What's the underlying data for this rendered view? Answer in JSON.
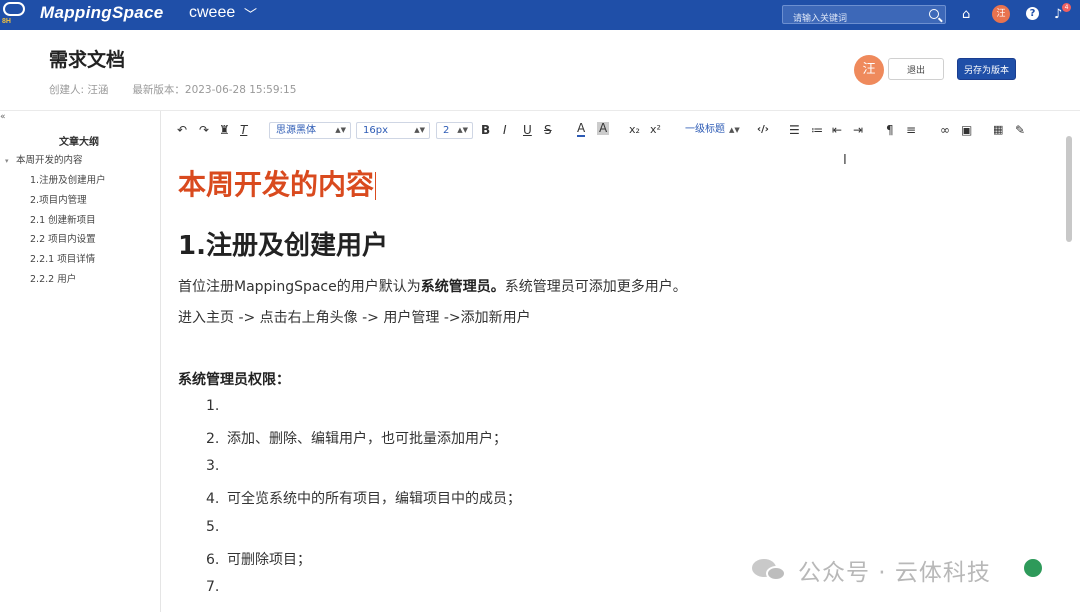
{
  "topbar": {
    "logo_sub": "8H",
    "logo_text": "MappingSpace",
    "project_name": "cweee",
    "search_placeholder": "请输入关键词",
    "avatar_initial": "汪",
    "help_label": "?",
    "bell_count": "4",
    "icons": [
      "home-icon",
      "help-icon",
      "bell-icon",
      "search-icon",
      "chevron-down-icon"
    ],
    "colors": {
      "nav_bg": "#1f4fa8",
      "avatar": "#e8734f"
    }
  },
  "doc": {
    "title": "需求文档",
    "creator": "创建人: 汪涵",
    "latest_version": "最新版本：2023-06-28 15:59:15",
    "avatar_initial": "汪",
    "exit_label": "退出",
    "save_as_label": "另存为版本"
  },
  "sidebar": {
    "collapse_label": "«",
    "outline_title": "文章大纲",
    "items": [
      {
        "label": "本周开发的内容"
      },
      {
        "label": "1.注册及创建用户"
      },
      {
        "label": "2.项目内管理"
      },
      {
        "label": "2.1 创建新项目"
      },
      {
        "label": "2.2 项目内设置"
      },
      {
        "label": "2.2.1 项目详情"
      },
      {
        "label": "2.2.2 用户"
      }
    ]
  },
  "toolbar": {
    "font_family": "思源黑体",
    "font_size": "16px",
    "line_height": "2",
    "heading": "一级标题",
    "icons": [
      "undo-icon",
      "redo-icon",
      "format-painter-icon",
      "clear-format-icon",
      "bold-icon",
      "italic-icon",
      "underline-icon",
      "strikethrough-icon",
      "font-color-icon",
      "highlight-icon",
      "subscript-icon",
      "superscript-icon",
      "code-icon",
      "ordered-list-icon",
      "unordered-list-icon",
      "outdent-icon",
      "indent-icon",
      "paragraph-icon",
      "align-icon",
      "link-icon",
      "image-icon",
      "table-icon",
      "clean-icon"
    ]
  },
  "editor": {
    "h_orange": "本周开发的内容",
    "h1": "1.注册及创建用户",
    "p1_pre": "首位注册MappingSpace的用户默认为",
    "p1_bold": "系统管理员。",
    "p1_post": "系统管理员可添加更多用户。",
    "p2": "进入主页 -> 点击右上角头像 -> 用户管理 ->添加新用户",
    "perm_title": "系统管理员权限：",
    "list": [
      {
        "num": "1.",
        "text": ""
      },
      {
        "num": "2.",
        "text": "添加、删除、编辑用户，也可批量添加用户；"
      },
      {
        "num": "3.",
        "text": ""
      },
      {
        "num": "4.",
        "text": "可全览系统中的所有项目，编辑项目中的成员；"
      },
      {
        "num": "5.",
        "text": ""
      },
      {
        "num": "6.",
        "text": "可删除项目；"
      },
      {
        "num": "7.",
        "text": ""
      }
    ],
    "accent_color": "#d94a1e"
  },
  "watermark": {
    "text": "公众号 · 云体科技"
  }
}
